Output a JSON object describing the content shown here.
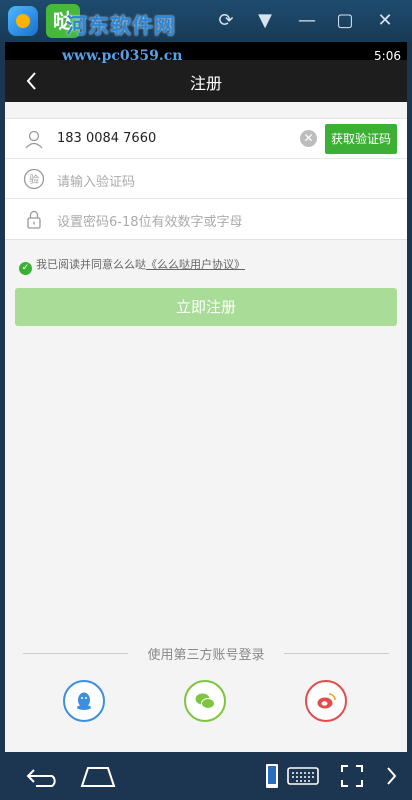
{
  "watermark": {
    "brand": "河东软件网",
    "url": "www.pc0359.cn"
  },
  "app_icon_char": "哒",
  "status_bar": {
    "time": "5:06"
  },
  "header": {
    "title": "注册"
  },
  "form": {
    "phone_value": "183 0084 7660",
    "get_code_label": "获取验证码",
    "code_icon_char": "验",
    "code_placeholder": "请输入验证码",
    "password_placeholder": "设置密码6-18位有效数字或字母"
  },
  "agreement": {
    "text": "我已阅读并同意么么哒",
    "link": "《么么哒用户协议》"
  },
  "register_label": "立即注册",
  "third_party": {
    "title": "使用第三方账号登录"
  },
  "colors": {
    "accent": "#3cb035",
    "register_disabled": "#a9dc97",
    "qq": "#3a8fe0",
    "wechat": "#7dc540",
    "weibo": "#e24c4c"
  }
}
